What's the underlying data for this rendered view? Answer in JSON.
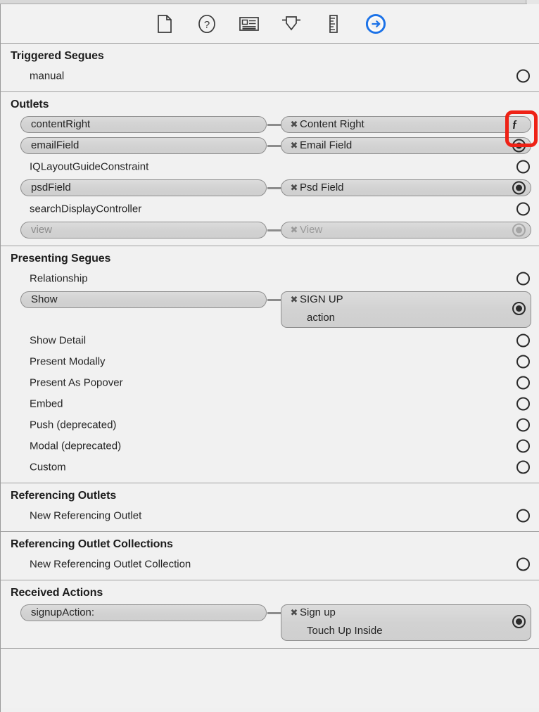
{
  "window": {
    "title": "Connections Inspector"
  },
  "inspector_tabs": [
    {
      "name": "file-inspector",
      "label": "File Inspector",
      "icon": "document-icon",
      "selected": false
    },
    {
      "name": "quick-help-inspector",
      "label": "Quick Help Inspector",
      "icon": "question-icon",
      "selected": false
    },
    {
      "name": "identity-inspector",
      "label": "Identity Inspector",
      "icon": "id-card-icon",
      "selected": false
    },
    {
      "name": "attributes-inspector",
      "label": "Attributes Inspector",
      "icon": "slider-down-icon",
      "selected": false
    },
    {
      "name": "size-inspector",
      "label": "Size Inspector",
      "icon": "ruler-icon",
      "selected": false
    },
    {
      "name": "connections-inspector",
      "label": "Connections Inspector",
      "icon": "arrow-circle-icon",
      "selected": true
    }
  ],
  "accent_color": "#1b72e8",
  "sections": [
    {
      "title": "Triggered Segues",
      "rows": [
        {
          "label": "manual",
          "connected": false,
          "well": "empty"
        }
      ]
    },
    {
      "title": "Outlets",
      "rows": [
        {
          "label": "contentRight",
          "connected": true,
          "target": "Content Right",
          "well": "hover",
          "highlighted": true
        },
        {
          "label": "emailField",
          "connected": true,
          "target": "Email Field",
          "well": "filled"
        },
        {
          "label": "IQLayoutGuideConstraint",
          "connected": false,
          "well": "empty"
        },
        {
          "label": "psdField",
          "connected": true,
          "target": "Psd Field",
          "well": "filled"
        },
        {
          "label": "searchDisplayController",
          "connected": false,
          "well": "empty"
        },
        {
          "label": "view",
          "connected": true,
          "target": "View",
          "well": "disabled",
          "disabled": true
        }
      ]
    },
    {
      "title": "Presenting Segues",
      "rows": [
        {
          "label": "Relationship",
          "connected": false,
          "well": "empty"
        },
        {
          "label": "Show",
          "connected": true,
          "target": "SIGN UP",
          "subtitle": "action",
          "well": "filled",
          "two_line": true
        },
        {
          "label": "Show Detail",
          "connected": false,
          "well": "empty"
        },
        {
          "label": "Present Modally",
          "connected": false,
          "well": "empty"
        },
        {
          "label": "Present As Popover",
          "connected": false,
          "well": "empty"
        },
        {
          "label": "Embed",
          "connected": false,
          "well": "empty"
        },
        {
          "label": "Push (deprecated)",
          "connected": false,
          "well": "empty"
        },
        {
          "label": "Modal (deprecated)",
          "connected": false,
          "well": "empty"
        },
        {
          "label": "Custom",
          "connected": false,
          "well": "empty"
        }
      ]
    },
    {
      "title": "Referencing Outlets",
      "rows": [
        {
          "label": "New Referencing Outlet",
          "connected": false,
          "well": "empty"
        }
      ]
    },
    {
      "title": "Referencing Outlet Collections",
      "rows": [
        {
          "label": "New Referencing Outlet Collection",
          "connected": false,
          "well": "empty"
        }
      ]
    },
    {
      "title": "Received Actions",
      "rows": [
        {
          "label": "signupAction:",
          "connected": true,
          "target": "Sign up",
          "subtitle": "Touch Up Inside",
          "well": "filled",
          "two_line": true
        }
      ]
    }
  ],
  "disconnect_glyph": "✖",
  "hover_glyph": "ƒ"
}
